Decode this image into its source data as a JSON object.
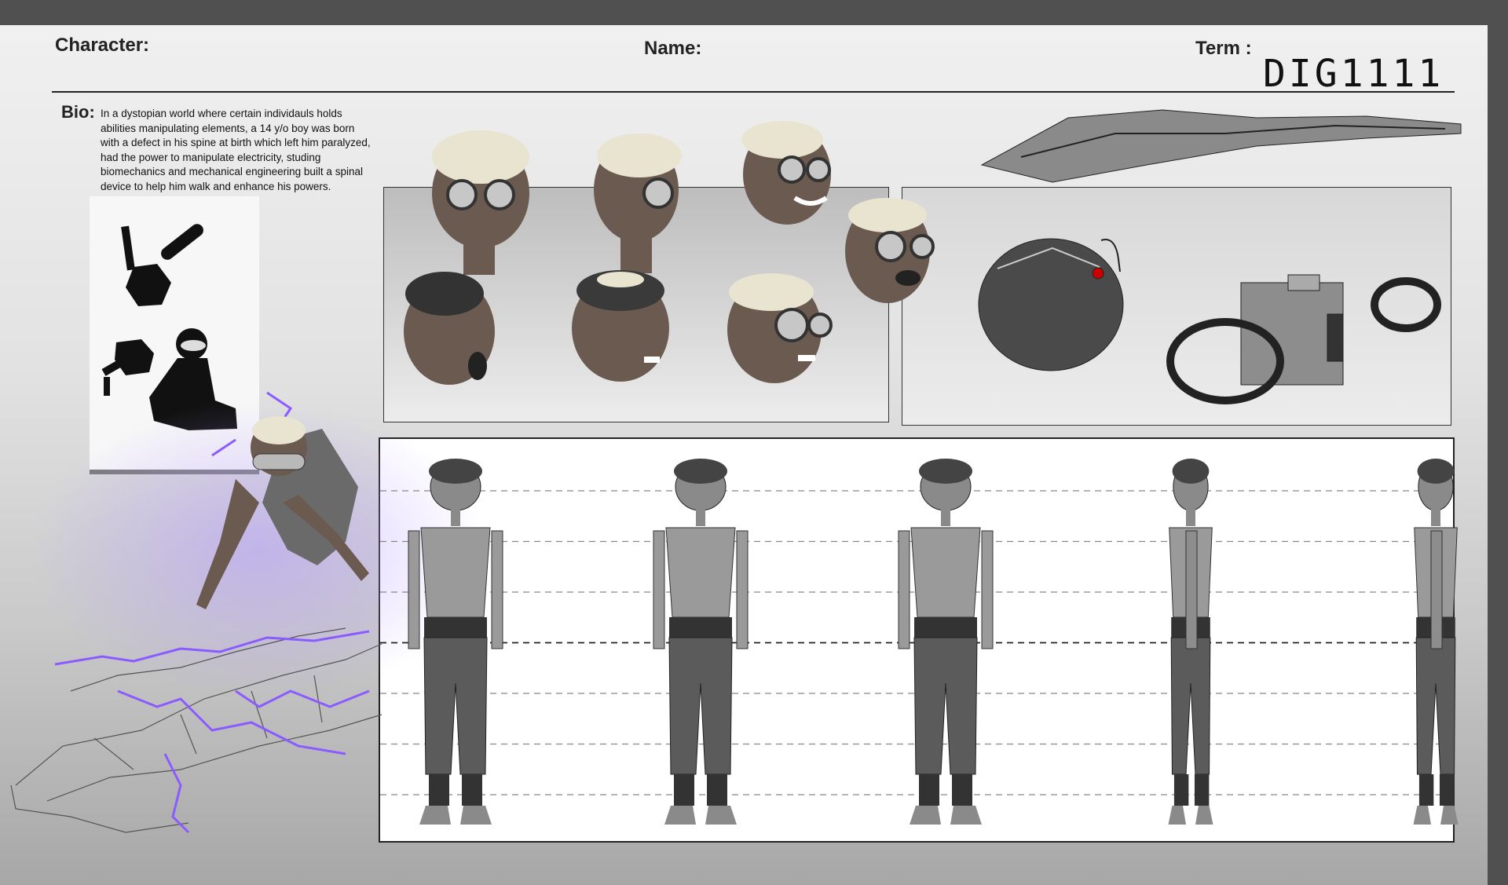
{
  "header": {
    "character_label": "Character:",
    "name_label": "Name:",
    "term_label": "Term :",
    "term_value": "DIG1111"
  },
  "bio": {
    "label": "Bio:",
    "lines": [
      "In a dystopian world where certain individauls holds",
      "abilities manipulating elements, a 14 y/o boy was born",
      "with a defect in his spine at birth which left him paralyzed,",
      "had the power to manipulate electricity, studing",
      "biomechanics and mechanical engineering built a spinal",
      "device  to help him walk and enhance his powers."
    ]
  },
  "colors": {
    "lightning": "#8a5cff",
    "skin": "#6b5a50",
    "hair": "#e8e4d0",
    "goggle": "#b9b9b9",
    "pants": "#5b5b5b"
  },
  "turnaround": {
    "views": 5,
    "guide_lines": 7
  },
  "head_studies": 8
}
